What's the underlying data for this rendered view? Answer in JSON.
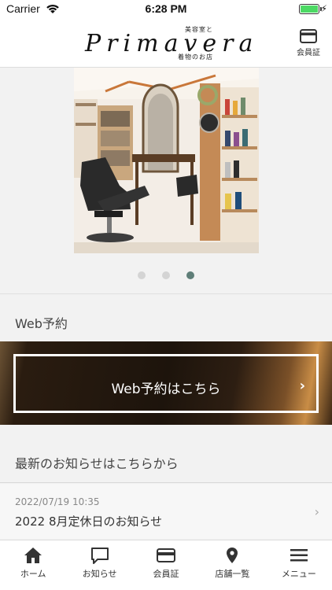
{
  "status": {
    "carrier": "Carrier",
    "time": "6:28 PM"
  },
  "header": {
    "logo_top": "美容室と",
    "logo_main": "Primavera",
    "logo_bottom": "着物のお店",
    "member_card_label": "会員証"
  },
  "carousel": {
    "slide_count": 3,
    "active_index": 2
  },
  "web_reservation": {
    "section_title": "Web予約",
    "button_label": "Web予約はこちら"
  },
  "news": {
    "section_title": "最新のお知らせはこちらから",
    "items": [
      {
        "date": "2022/07/19 10:35",
        "title": "2022 8月定休日のお知らせ"
      }
    ]
  },
  "tabbar": {
    "tabs": [
      {
        "label": "ホーム",
        "icon": "home-icon"
      },
      {
        "label": "お知らせ",
        "icon": "message-icon"
      },
      {
        "label": "会員証",
        "icon": "card-icon"
      },
      {
        "label": "店舗一覧",
        "icon": "location-pin-icon"
      },
      {
        "label": "メニュー",
        "icon": "hamburger-menu-icon"
      }
    ]
  },
  "colors": {
    "accent": "#5f7e78",
    "battery": "#4cd964",
    "banner_dark": "#1d140c",
    "banner_gold": "#c98d46"
  }
}
